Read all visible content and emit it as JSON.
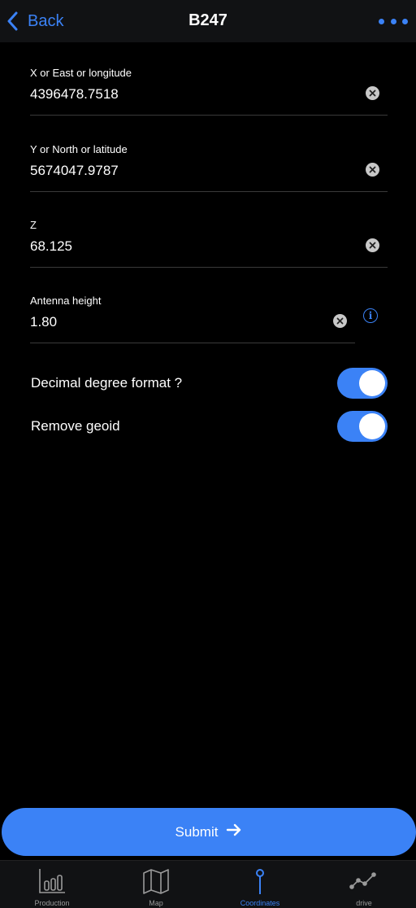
{
  "header": {
    "back_label": "Back",
    "title": "B247",
    "more_icon": "more-horizontal-icon",
    "accent_color": "#3b82f6"
  },
  "fields": [
    {
      "label": "X or East or longitude",
      "value": "4396478.7518"
    },
    {
      "label": "Y or North or latitude",
      "value": "5674047.9787"
    },
    {
      "label": "Z",
      "value": "68.125"
    },
    {
      "label": "Antenna height",
      "value": "1.80"
    }
  ],
  "toggles": [
    {
      "label": "Decimal degree format ?",
      "on": true
    },
    {
      "label": "Remove geoid",
      "on": true
    }
  ],
  "submit": {
    "label": "Submit",
    "icon": "arrow-right-icon"
  },
  "tabs": [
    {
      "label": "Production",
      "icon": "bar-chart-icon",
      "active": false
    },
    {
      "label": "Map",
      "icon": "map-icon",
      "active": false
    },
    {
      "label": "Coordinates",
      "icon": "location-pin-icon",
      "active": true
    },
    {
      "label": "drive",
      "icon": "line-graph-icon",
      "active": false
    }
  ]
}
